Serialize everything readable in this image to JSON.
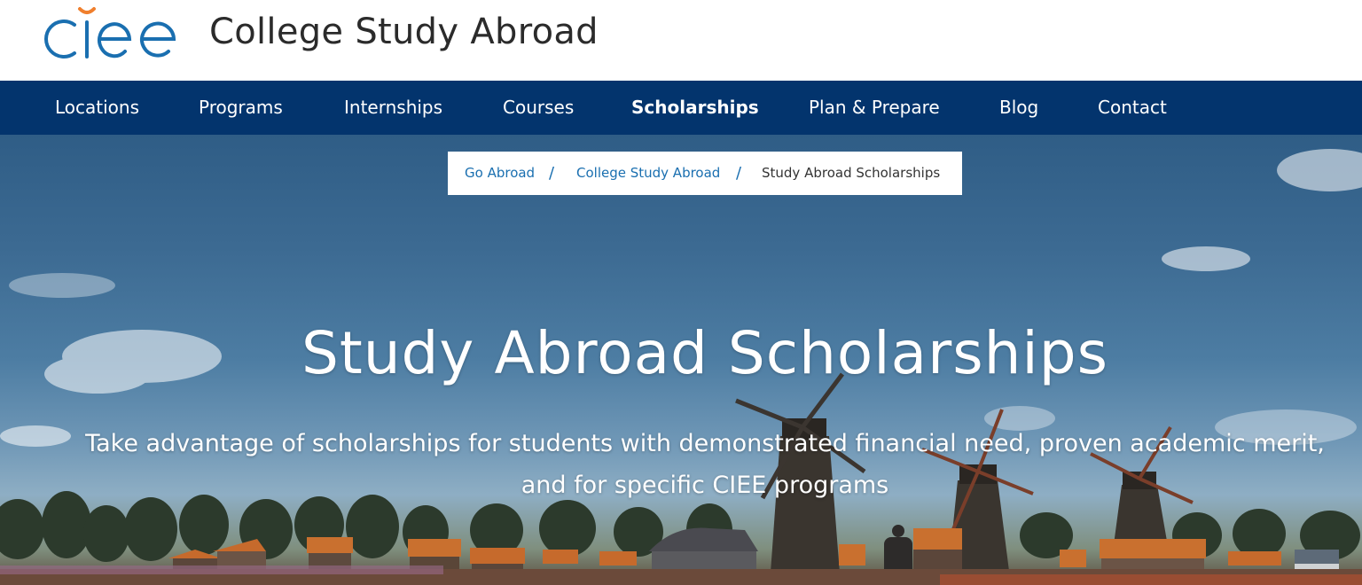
{
  "header": {
    "logo_text": "ciee",
    "site_title": "College Study Abroad"
  },
  "nav": {
    "items": [
      {
        "label": "Locations"
      },
      {
        "label": "Programs"
      },
      {
        "label": "Internships"
      },
      {
        "label": "Courses"
      },
      {
        "label": "Scholarships",
        "active": true
      },
      {
        "label": "Plan & Prepare"
      },
      {
        "label": "Blog"
      },
      {
        "label": "Contact"
      }
    ]
  },
  "breadcrumb": {
    "items": [
      "Go Abroad",
      "College Study Abroad",
      "Study Abroad Scholarships"
    ],
    "separator": "/"
  },
  "hero": {
    "title": "Study Abroad Scholarships",
    "subtitle": "Take advantage of scholarships for students with demonstrated financial need, proven academic merit, and for specific CIEE programs"
  },
  "colors": {
    "brand_blue": "#1a6fb0",
    "logo_accent": "#f07f2d",
    "nav_bg": "#03346d",
    "breadcrumb_link": "#1a6fb0"
  }
}
